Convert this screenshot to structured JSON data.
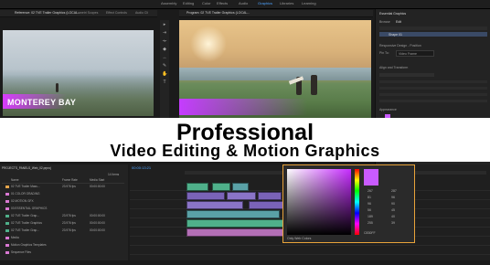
{
  "workspaces": [
    "Assembly",
    "Editing",
    "Color",
    "Effects",
    "Audio",
    "Graphics",
    "Libraries",
    "Learning"
  ],
  "active_workspace": "Graphics",
  "source_panel": {
    "tabs": [
      "Reference: 02 TVE Trailer Graphics (LOCAL...",
      "Lumetri Scopes",
      "Effect Controls",
      "Audio Cli"
    ],
    "title_text": "MONTEREY BAY"
  },
  "program_panel": {
    "tab": "Program: 02 TVE Trailer Graphics (LOCAL..."
  },
  "essential_graphics": {
    "tab": "Essential Graphics",
    "browse": "Browse",
    "edit": "Edit",
    "layer": "Shape 01",
    "section_responsive": "Responsive Design - Position",
    "pin_to": "Pin To:",
    "pin_value": "Video Frame",
    "section_align": "Align and Transform",
    "section_appearance": "Appearance"
  },
  "banner": {
    "title": "Professional",
    "subtitle": "Video Editing & Motion Graphics"
  },
  "project_panel": {
    "path": "PROJECTS_PANELS_Web_02.prproj",
    "count": "14 Items",
    "col_name": "Name",
    "col_rate": "Frame Rate",
    "col_start": "Media Start",
    "rows": [
      {
        "name": "02 TVE Trailer Mass...",
        "rate": "23.976 fps",
        "start": "00:00:00:00",
        "color": "#e5a54b"
      },
      {
        "name": "01 COLOR GRADING",
        "rate": "",
        "start": "",
        "color": "#d978d2"
      },
      {
        "name": "02 MOTION GFX",
        "rate": "",
        "start": "",
        "color": "#d978d2"
      },
      {
        "name": "03 ESSENTIAL GRAPHICS",
        "rate": "",
        "start": "",
        "color": "#d978d2"
      },
      {
        "name": "02 TVE Trailer Grap...",
        "rate": "23.976 fps",
        "start": "00:00:00:00",
        "color": "#4fb08a"
      },
      {
        "name": "02 TVE Trailer Graphics",
        "rate": "23.976 fps",
        "start": "00:00:00:00",
        "color": "#4fb08a"
      },
      {
        "name": "02 TVE Trailer Grap...",
        "rate": "23.976 fps",
        "start": "00:00:00:00",
        "color": "#4fb08a"
      },
      {
        "name": "Media",
        "rate": "",
        "start": "",
        "color": "#d978d2"
      },
      {
        "name": "Motion Graphics Templates",
        "rate": "",
        "start": "",
        "color": "#d978d2"
      },
      {
        "name": "Sequence Files",
        "rate": "",
        "start": "",
        "color": "#d978d2"
      }
    ]
  },
  "timeline": {
    "timecode": "00:00:13:21"
  },
  "color_picker": {
    "only_web_colors": "Only Web Colors",
    "values": [
      "267",
      "81",
      "96",
      "56",
      "189",
      "255",
      "287",
      "96",
      "90",
      "45",
      "40",
      "39"
    ],
    "hex_label": "C830FF",
    "accent": "#c830ff"
  }
}
